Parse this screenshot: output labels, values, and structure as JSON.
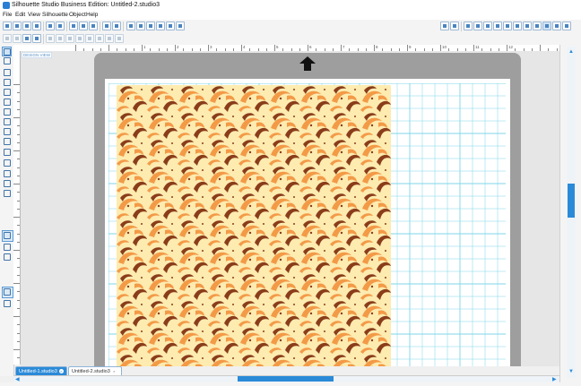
{
  "window": {
    "title": "Silhouette Studio Business Edition: Untitled-2.studio3"
  },
  "menu": [
    "File",
    "Edit",
    "View",
    "Silhouette",
    "Object",
    "Help"
  ],
  "ruler": {
    "numbers": [
      "1",
      "2",
      "3",
      "4",
      "5",
      "6",
      "7",
      "8",
      "9",
      "10",
      "11",
      "12"
    ]
  },
  "canvas": {
    "view_label": "DESIGN VIEW",
    "grid_color": "#7fd6e8",
    "mat_color": "#9e9e9e",
    "pattern_colors": {
      "background": "#fdebb0",
      "light": "#f39a47",
      "dark": "#8a3d1a"
    }
  },
  "tabs": [
    {
      "label": "Untitled-1.studio3",
      "active": true
    },
    {
      "label": "Untitled-2.studio3",
      "active": false
    }
  ],
  "tab_close_glyph": "×",
  "accent": "#2a8ad8"
}
